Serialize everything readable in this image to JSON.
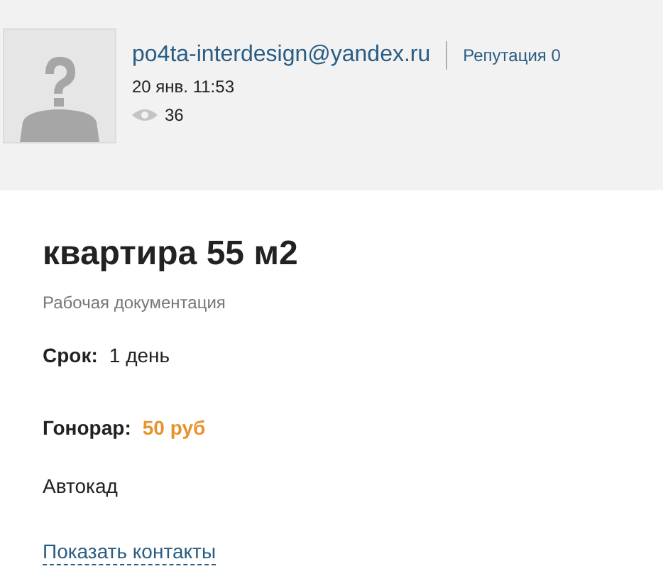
{
  "author": {
    "email": "po4ta-interdesign@yandex.ru",
    "reputation": "Репутация 0",
    "date": "20 янв. 11:53",
    "views": "36"
  },
  "task": {
    "title": "квартира 55 м2",
    "category": "Рабочая документация",
    "fields": [
      {
        "label": "Срок:",
        "value": "1 день",
        "kind": "plain"
      },
      {
        "label": "Гонорар:",
        "value": "50 руб",
        "kind": "price"
      }
    ],
    "description": "Автокад",
    "contacts_link": "Показать контакты"
  }
}
